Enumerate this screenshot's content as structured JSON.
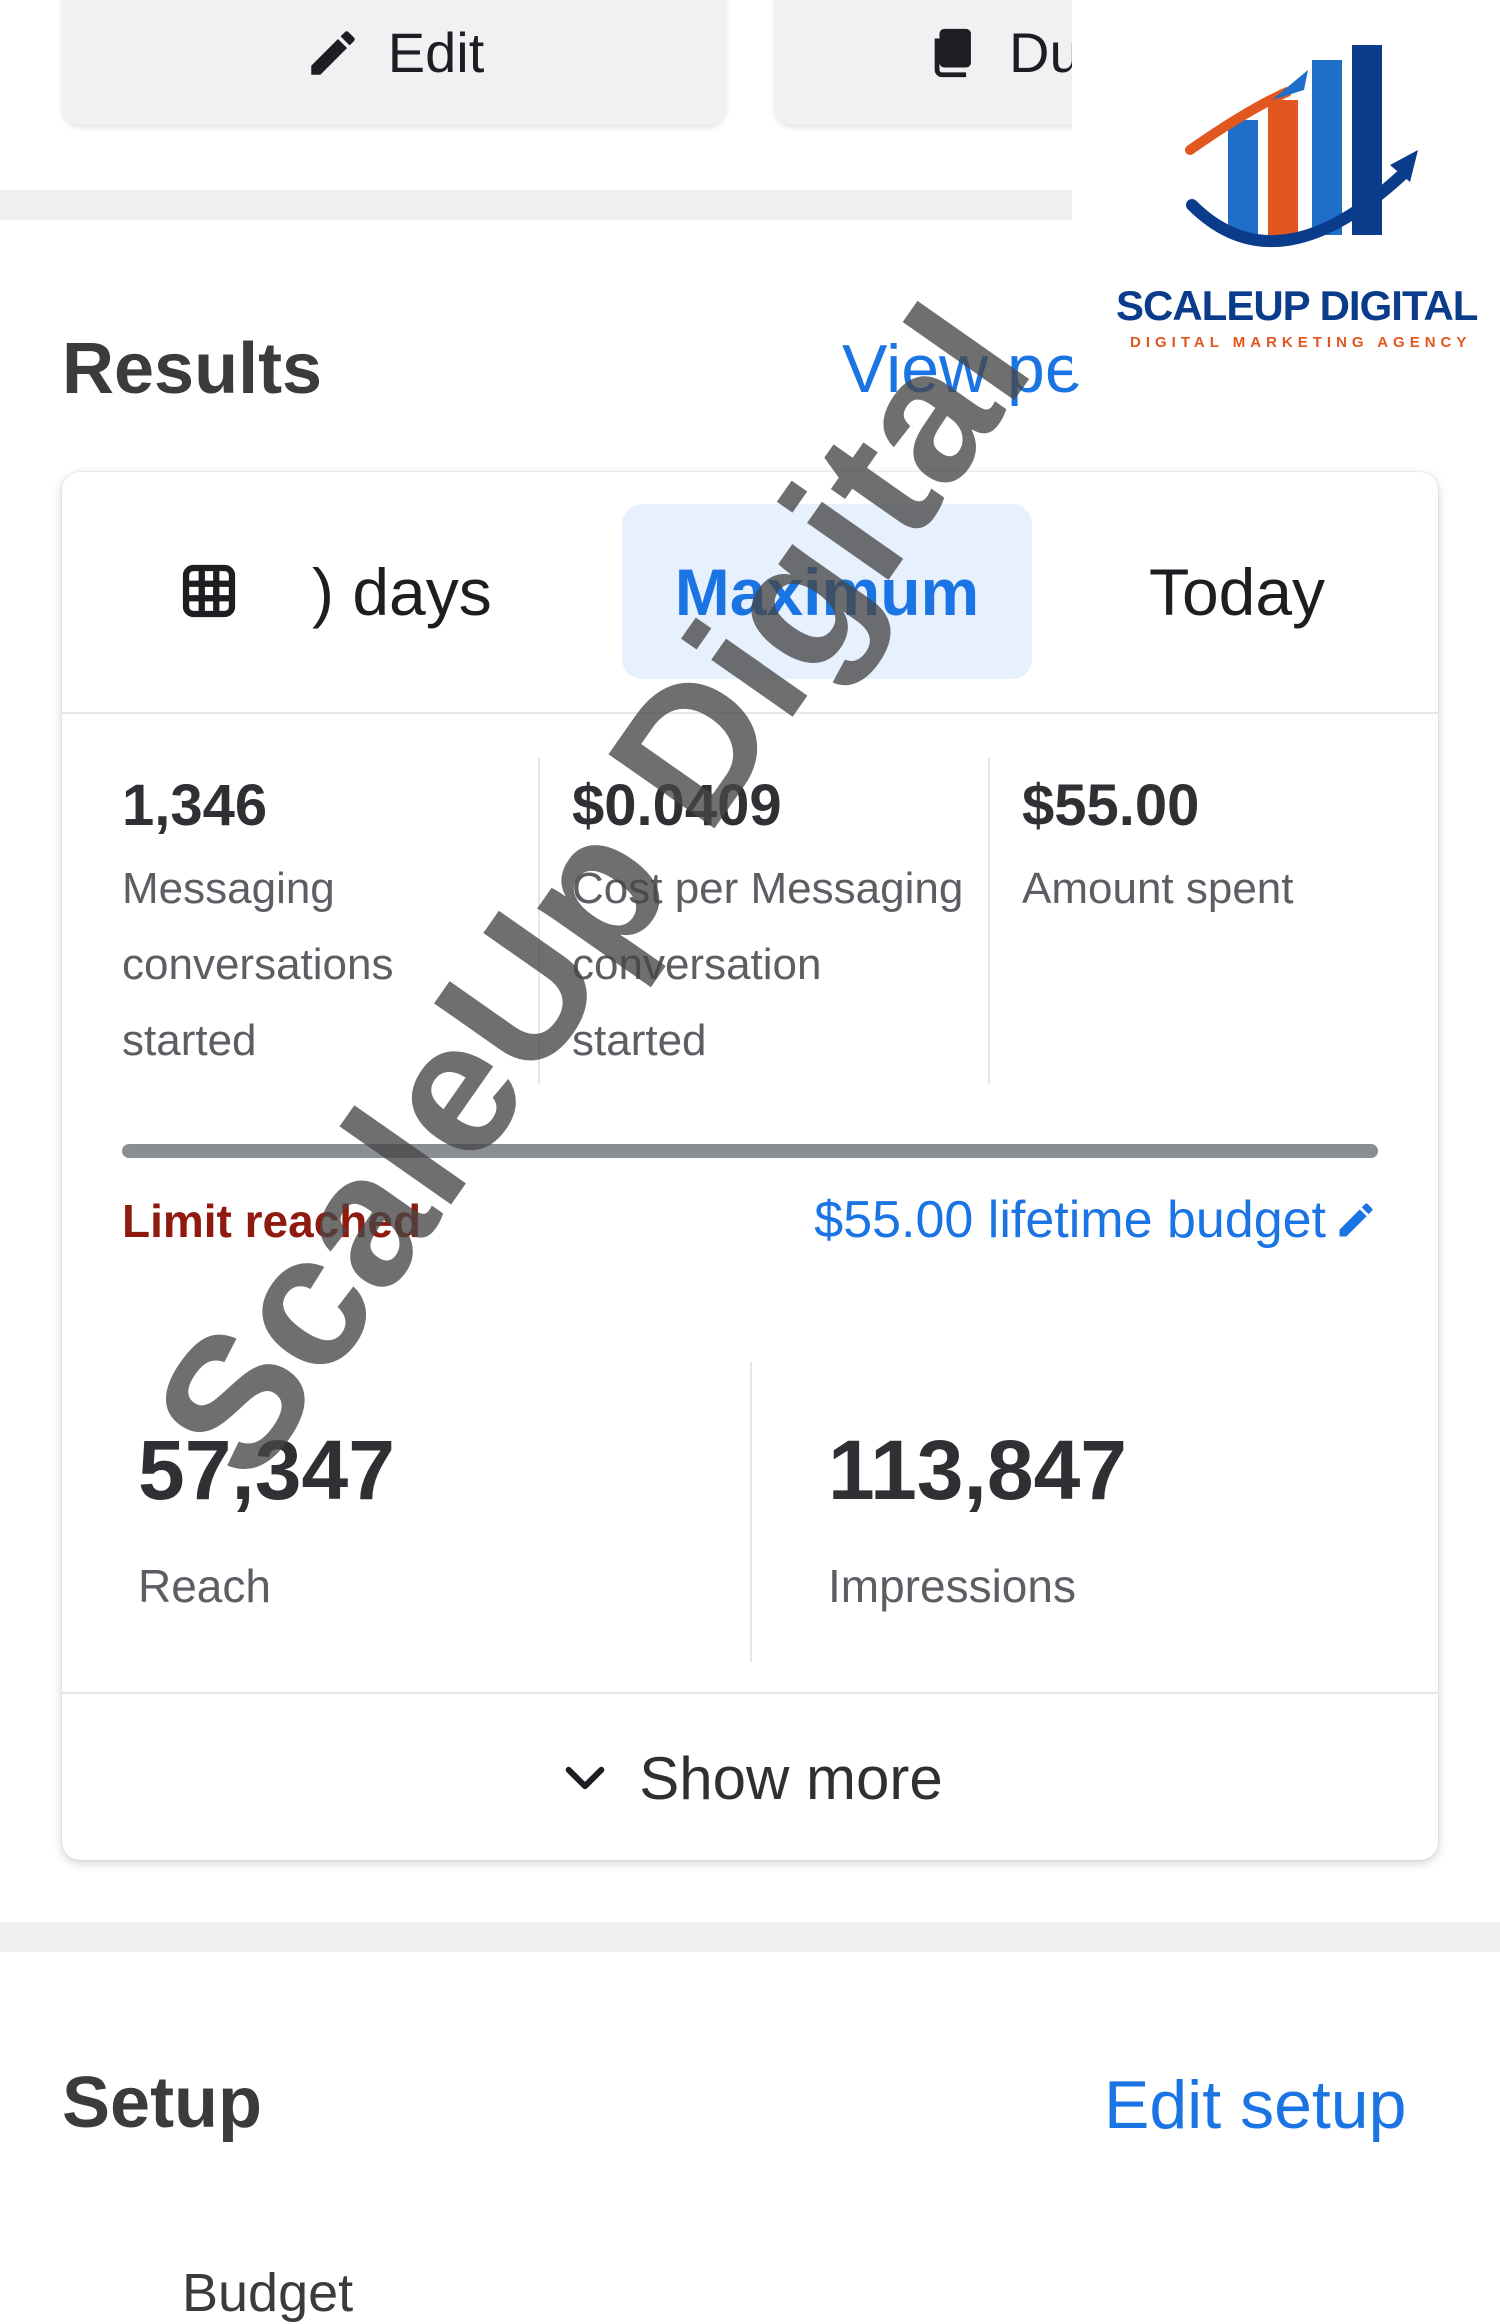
{
  "toolbar": {
    "edit_label": "Edit",
    "duplicate_label": "Du"
  },
  "results": {
    "title": "Results",
    "view_link": "View pe",
    "tabs": [
      {
        "label": ") days",
        "active": false
      },
      {
        "label": "Maximum",
        "active": true
      },
      {
        "label": "Today",
        "active": false
      }
    ],
    "metrics": [
      {
        "value": "1,346",
        "label": "Messaging\nconversations\nstarted"
      },
      {
        "value": "$0.0409",
        "label": "Cost per Messaging\nconversation\nstarted"
      },
      {
        "value": "$55.00",
        "label": "Amount spent"
      }
    ],
    "budget_progress": 1.0,
    "limit_text": "Limit reached",
    "budget_text": "$55.00 lifetime budget",
    "reach": {
      "value": "57,347",
      "label": "Reach"
    },
    "impressions": {
      "value": "113,847",
      "label": "Impressions"
    },
    "show_more": "Show more"
  },
  "setup": {
    "title": "Setup",
    "edit_link": "Edit setup",
    "budget_label": "Budget"
  },
  "logo": {
    "name": "SCALEUP DIGITAL",
    "tagline": "DIGITAL MARKETING AGENCY"
  },
  "watermark": "ScaleUp Digital",
  "colors": {
    "accent": "#1b74e4",
    "limit": "#8f1b10",
    "active_tab_bg": "#e7f0fd"
  },
  "icons": [
    "pencil-icon",
    "duplicate-icon",
    "calendar-icon",
    "chevron-down-icon",
    "edit-pencil-icon"
  ]
}
